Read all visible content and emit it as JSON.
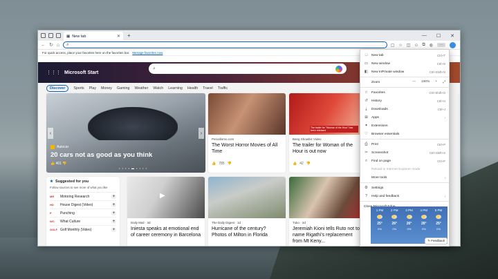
{
  "browser": {
    "tab_title": "New tab",
    "new_tab_symbol": "+",
    "window_controls": [
      "—",
      "☐",
      "✕"
    ],
    "address_placeholder": "",
    "favorites_bar_text": "For quick access, place your favorites here on the favorites bar.",
    "favorites_bar_link": "Manage favorites now"
  },
  "msn": {
    "brand": "Microsoft Start",
    "categories": [
      "Discover",
      "Sports",
      "Play",
      "Money",
      "Gaming",
      "Weather",
      "Watch",
      "Learning",
      "Health",
      "Travel",
      "Traffic"
    ],
    "hero_card": {
      "source": "Autocar",
      "title": "20 cars not as good as you think",
      "likes": "401"
    },
    "cards": [
      {
        "source": "Periodismo.com",
        "title": "The Worst Horror Movies of All Time",
        "likes": "785"
      },
      {
        "source": "Bang Showbiz Video",
        "title": "The trailer for Woman of the Hour is out now",
        "likes": "42",
        "overlay": "The trailer for \"Woman of the Hour\" has been released"
      },
      {
        "source": "Daily Mail · 3d",
        "title": "Iniesta speaks at emotional end of career ceremony in Barcelona"
      },
      {
        "source": "The Daily Digest · 1d",
        "title": "Hurricane of the century? Photos of Milton in Florida"
      },
      {
        "source": "Tuko · 2d",
        "title": "Jeremiah Kioni tells Ruto not to name Rigathi's replacement from Mt Keny..."
      }
    ],
    "suggested": {
      "title": "Suggested for you",
      "hint": "Follow sources to see more of what you like",
      "items": [
        {
          "logo": "MR",
          "name": "Motoring Research"
        },
        {
          "logo": "HD",
          "name": "House Digest (Video)"
        },
        {
          "logo": "P",
          "name": "Punching"
        },
        {
          "logo": "WC",
          "name": "What Culture"
        },
        {
          "logo": "GOLF",
          "name": "Golf Monthly (Video)"
        }
      ]
    }
  },
  "menu": {
    "items": [
      {
        "label": "New tab",
        "shortcut": "Ctrl+T",
        "icon": "□"
      },
      {
        "label": "New window",
        "shortcut": "Ctrl+N",
        "icon": "▭"
      },
      {
        "label": "New InPrivate window",
        "shortcut": "Ctrl+Shift+N",
        "icon": "◧"
      },
      {
        "label": "Zoom",
        "shortcut": "",
        "icon": ""
      },
      {
        "label": "Favorites",
        "shortcut": "Ctrl+Shift+O",
        "icon": "☆"
      },
      {
        "label": "History",
        "shortcut": "Ctrl+H",
        "icon": "↺"
      },
      {
        "label": "Downloads",
        "shortcut": "Ctrl+J",
        "icon": "⤓"
      },
      {
        "label": "Apps",
        "shortcut": "›",
        "icon": "⊞"
      },
      {
        "label": "Extensions",
        "shortcut": "",
        "icon": "✦"
      },
      {
        "label": "Browser essentials",
        "shortcut": "",
        "icon": "♡"
      },
      {
        "label": "Print",
        "shortcut": "Ctrl+P",
        "icon": "⎙"
      },
      {
        "label": "Screenshot",
        "shortcut": "Ctrl+Shift+S",
        "icon": "✂"
      },
      {
        "label": "Find on page",
        "shortcut": "Ctrl+F",
        "icon": "⌕"
      },
      {
        "label": "Reload in Internet Explorer mode",
        "shortcut": "",
        "icon": ""
      },
      {
        "label": "More tools",
        "shortcut": "›",
        "icon": ""
      },
      {
        "label": "Settings",
        "shortcut": "",
        "icon": "⚙"
      },
      {
        "label": "Help and feedback",
        "shortcut": "›",
        "icon": "?"
      },
      {
        "label": "Close Microsoft Edge",
        "shortcut": "",
        "icon": ""
      }
    ],
    "zoom_minus": "—",
    "zoom_value": "100%",
    "zoom_plus": "+",
    "zoom_fullscreen": "⤢"
  },
  "weather": {
    "days": [
      {
        "time": "1 PM",
        "temp": "25°",
        "precip": "0%"
      },
      {
        "time": "2 PM",
        "temp": "26°",
        "precip": "0%"
      },
      {
        "time": "3 PM",
        "temp": "26°",
        "precip": "0%"
      },
      {
        "time": "4 PM",
        "temp": "26°",
        "precip": "0%"
      },
      {
        "time": "5 PM",
        "temp": "25°",
        "precip": "0%"
      }
    ],
    "feedback": "Feedback"
  }
}
